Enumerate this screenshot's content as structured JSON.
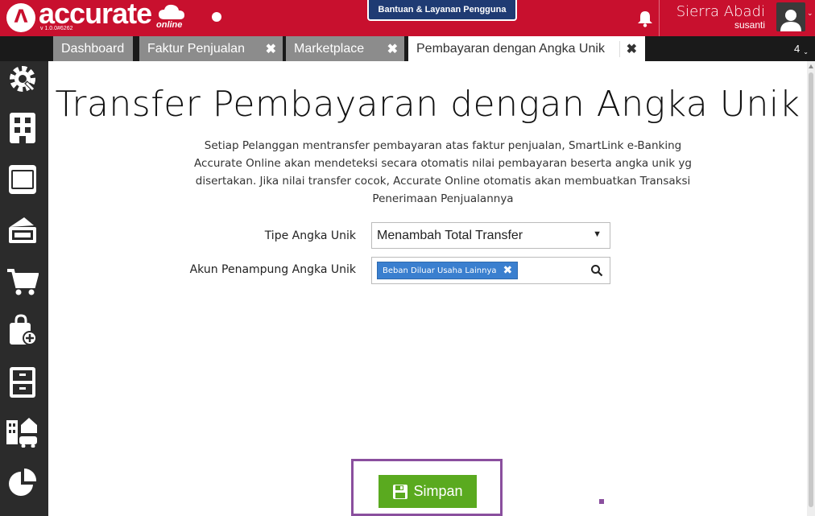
{
  "header": {
    "logo_text": "accurate",
    "logo_online": "online",
    "logo_mark": "Λ",
    "version": "v 1.0.0#6262",
    "help_button": "Bantuan & Layanan Pengguna",
    "user_name": "Sierra Abadi",
    "user_sub": "susanti",
    "caret": "⌄"
  },
  "tabs": [
    {
      "label": "Dashboard",
      "closable": false
    },
    {
      "label": "Faktur Penjualan",
      "closable": true
    },
    {
      "label": "Marketplace",
      "closable": true
    },
    {
      "label": "Pembayaran dengan Angka Unik",
      "closable": true,
      "active": true
    }
  ],
  "tab_close": "✖",
  "tab_count": "4",
  "sidebar": {
    "icons": [
      "gear-icon",
      "building-icon",
      "ledger-icon",
      "cash-icon",
      "cart-icon",
      "bag-plus-icon",
      "cabinet-icon",
      "assets-icon",
      "pie-chart-icon"
    ]
  },
  "main": {
    "title": "Transfer Pembayaran dengan Angka Unik",
    "description": "Setiap Pelanggan mentransfer pembayaran atas faktur penjualan, SmartLink e-Banking Accurate Online akan mendeteksi secara otomatis nilai pembayaran beserta angka unik yg disertakan. Jika nilai transfer cocok, Accurate Online otomatis akan membuatkan Transaksi Penerimaan Penjualannya",
    "tipe_label": "Tipe Angka Unik",
    "tipe_value": "Menambah Total Transfer",
    "akun_label": "Akun Penampung Angka Unik",
    "akun_tag": "Beban Diluar Usaha Lainnya",
    "akun_tag_remove": "✖",
    "select_arrow": "▼",
    "save_label": "Simpan"
  },
  "colors": {
    "brand_red": "#c8102e",
    "save_green": "#5aaa1f",
    "highlight_purple": "#8a4f9e",
    "tag_blue": "#3a7fcf"
  }
}
